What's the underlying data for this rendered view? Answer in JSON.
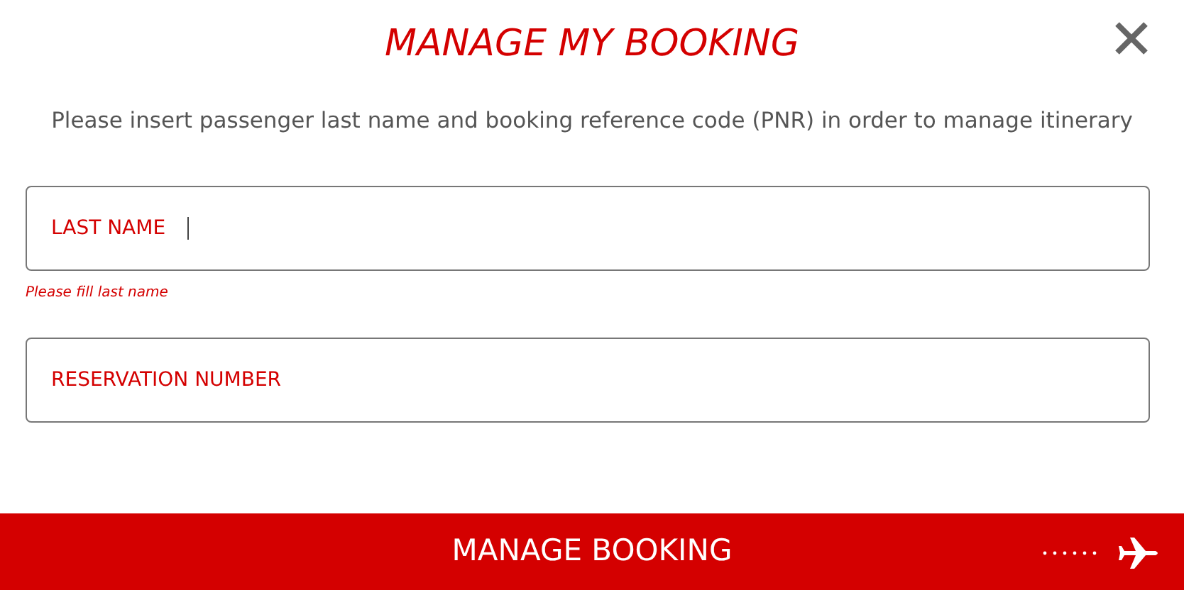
{
  "title": "MANAGE MY BOOKING",
  "instructions": "Please insert passenger last name and booking reference code (PNR) in order to manage itinerary",
  "fields": [
    {
      "label": "LAST NAME",
      "focused": true,
      "error": "Please fill last name"
    },
    {
      "label": "RESERVATION NUMBER",
      "focused": false
    }
  ],
  "submit_button": {
    "label": "MANAGE BOOKING"
  }
}
